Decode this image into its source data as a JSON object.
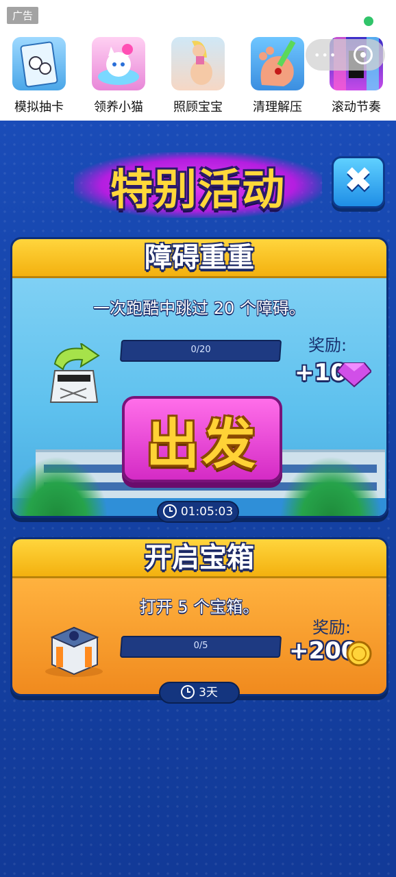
{
  "ad_bar": {
    "tag": "广告",
    "items": [
      {
        "label": "模拟抽卡",
        "icon": "card-pack-icon",
        "color": "#8fd0f5"
      },
      {
        "label": "领养小猫",
        "icon": "cat-icon",
        "color": "#f7a8e6"
      },
      {
        "label": "照顾宝宝",
        "icon": "pregnant-woman-icon",
        "color": "#f2c9a8"
      },
      {
        "label": "清理解压",
        "icon": "foot-icon",
        "color": "#f08a6a"
      },
      {
        "label": "滚动节奏",
        "icon": "rhythm-tile-icon",
        "color": "#a64ad8"
      }
    ]
  },
  "header": {
    "title": "特别活动",
    "close_icon": "close-icon"
  },
  "tasks": [
    {
      "title": "障碍重重",
      "description": "一次跑酷中跳过 20 个障碍。",
      "progress_text": "0/20",
      "progress_value": 0,
      "reward_label": "奖励:",
      "reward_amount": "+10",
      "reward_icon": "gem-icon",
      "button_label": "出发",
      "timer": "01:05:03"
    },
    {
      "title": "开启宝箱",
      "description": "打开 5 个宝箱。",
      "progress_text": "0/5",
      "progress_value": 0,
      "reward_label": "奖励:",
      "reward_amount": "+200",
      "reward_icon": "coin-icon",
      "timer": "3天"
    }
  ]
}
